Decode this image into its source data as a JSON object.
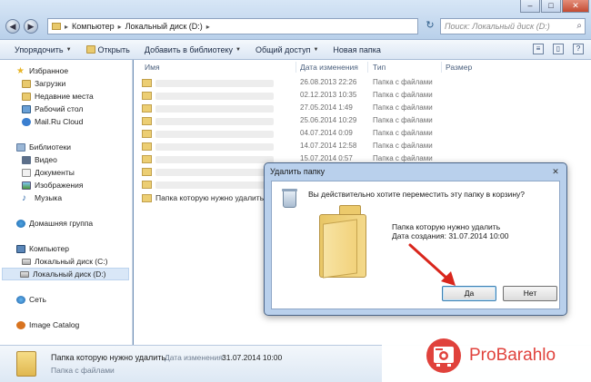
{
  "address": {
    "crumbs": [
      "Компьютер",
      "Локальный диск (D:)"
    ],
    "search_placeholder": "Поиск: Локальный диск (D:)"
  },
  "toolbar": {
    "organize": "Упорядочить",
    "open": "Открыть",
    "add_to_library": "Добавить в библиотеку",
    "share": "Общий доступ",
    "new_folder": "Новая папка"
  },
  "nav": {
    "favorites": "Избранное",
    "downloads": "Загрузки",
    "recent": "Недавние места",
    "desktop": "Рабочий стол",
    "mailru": "Mail.Ru Cloud",
    "libraries": "Библиотеки",
    "video": "Видео",
    "documents": "Документы",
    "images": "Изображения",
    "music": "Музыка",
    "homegroup": "Домашняя группа",
    "computer": "Компьютер",
    "drive_c": "Локальный диск (C:)",
    "drive_d": "Локальный диск (D:)",
    "network": "Сеть",
    "image_catalog": "Image Catalog"
  },
  "columns": {
    "name": "Имя",
    "date": "Дата изменения",
    "type": "Тип",
    "size": "Размер"
  },
  "rows": [
    {
      "date": "26.08.2013 22:26",
      "type": "Папка с файлами"
    },
    {
      "date": "02.12.2013 10:35",
      "type": "Папка с файлами"
    },
    {
      "date": "27.05.2014 1:49",
      "type": "Папка с файлами"
    },
    {
      "date": "25.06.2014 10:29",
      "type": "Папка с файлами"
    },
    {
      "date": "04.07.2014 0:09",
      "type": "Папка с файлами"
    },
    {
      "date": "14.07.2014 12:58",
      "type": "Папка с файлами"
    },
    {
      "date": "15.07.2014 0:57",
      "type": "Папка с файлами"
    }
  ],
  "target_row": {
    "name": "Папка которую нужно удалить"
  },
  "details": {
    "name": "Папка которую нужно удалить",
    "date_label": "Дата изменения:",
    "date_value": "31.07.2014 10:00",
    "type": "Папка с файлами"
  },
  "dialog": {
    "title": "Удалить папку",
    "question": "Вы действительно хотите переместить эту папку в корзину?",
    "folder_name": "Папка которую нужно удалить",
    "created": "Дата создания: 31.07.2014 10:00",
    "yes": "Да",
    "no": "Нет"
  },
  "watermark": {
    "text": "ProBarahlo"
  },
  "colors": {
    "accent": "#e0423c",
    "arrow": "#d9261c"
  }
}
